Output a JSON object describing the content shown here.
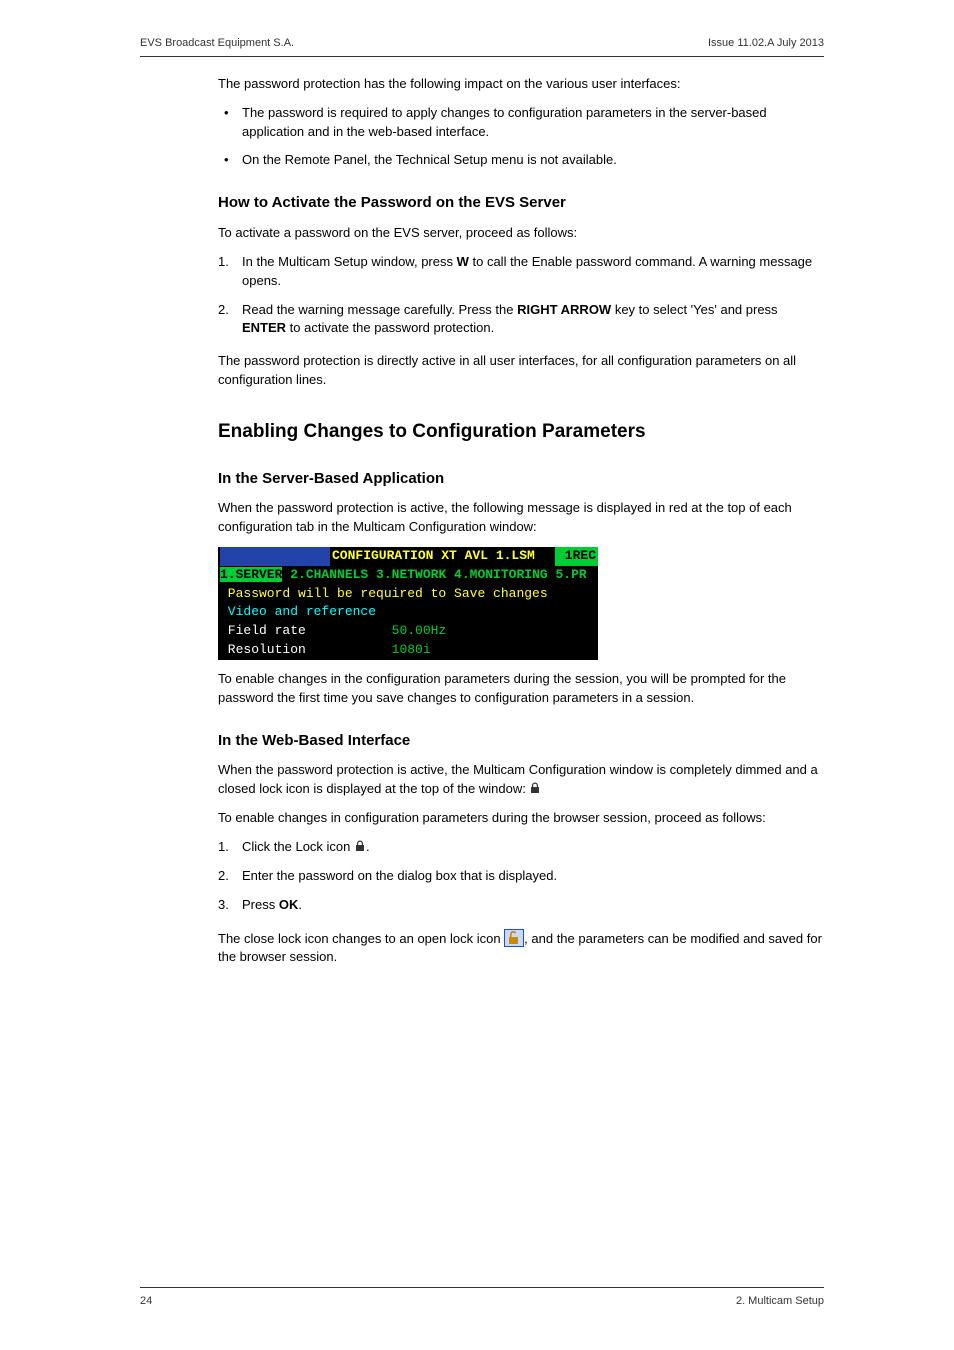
{
  "header": {
    "left": "EVS Broadcast Equipment S.A.",
    "right": "Issue 11.02.A  July 2013"
  },
  "intro": {
    "p1": "The password protection has the following impact on the various user interfaces:",
    "b1": "The password is required to apply changes to configuration parameters in the server-based application and in the web-based interface.",
    "b2": "On the Remote Panel, the Technical Setup menu is not available."
  },
  "activate": {
    "h": "How to Activate the Password on the EVS Server",
    "p1": "To activate a password on the EVS server, proceed as follows:",
    "s1a": "In the Multicam Setup window, press ",
    "s1key": "W",
    "s1b": " to call the Enable password command. A warning message opens.",
    "s2a": "Read the warning message carefully. Press the ",
    "s2key1": "RIGHT ARROW",
    "s2b": " key to select 'Yes' and press ",
    "s2key2": "ENTER",
    "s2c": " to activate the password protection.",
    "p2": "The password protection is directly active in all user interfaces, for all configuration parameters on all configuration lines."
  },
  "enabling": {
    "h": "Enabling Changes to Configuration Parameters",
    "server": {
      "h": "In the Server-Based Application",
      "p1": "When the password protection is active, the following message is displayed in red at the top of each configuration tab in the Multicam Configuration window:",
      "p2": "To enable changes in the configuration parameters during the session, you will be prompted for the password the first time you save changes to configuration parameters in a session."
    },
    "web": {
      "h": "In the Web-Based Interface",
      "p1": "When the password protection is active, the Multicam Configuration window is completely dimmed and a closed lock icon is displayed at the top of the window:  ",
      "p2": "To enable changes in configuration parameters during the browser session, proceed as follows:",
      "s1": "Click the Lock icon ",
      "s1b": ".",
      "s2": "Enter the password on the dialog box that is displayed.",
      "s3a": "Press ",
      "s3key": "OK",
      "s3b": ".",
      "p3a": "The close lock icon changes to an open lock icon ",
      "p3b": ", and the parameters can be modified and saved for the browser session."
    }
  },
  "terminal": {
    "l1_mid": "CONFIGURATION XT AVL 1.LSM ",
    "l1_end": " 1REC",
    "l2_sel": "1.SERVER",
    "l2_rest": " 2.CHANNELS 3.NETWORK 4.MONITORING 5.PR",
    "l3": " Password will be required to Save changes",
    "l4": " Video and reference",
    "l5_label": " Field rate           ",
    "l5_val": "50.00Hz",
    "l6_label": " Resolution           ",
    "l6_val": "1080i"
  },
  "footer": {
    "left": "24",
    "right": "2. Multicam Setup"
  }
}
